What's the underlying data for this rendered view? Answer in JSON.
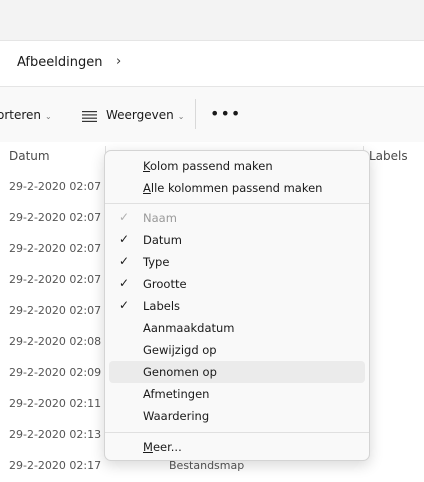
{
  "breadcrumb": {
    "current": "Afbeeldingen",
    "separator": "›"
  },
  "toolbar": {
    "sort_label": "orteren",
    "view_label": "Weergeven",
    "more_label": "•••"
  },
  "columns": {
    "datum": "Datum",
    "labels": "Labels"
  },
  "rows": [
    {
      "date": "29-2-2020 02:07",
      "type": ""
    },
    {
      "date": "29-2-2020 02:07",
      "type": ""
    },
    {
      "date": "29-2-2020 02:07",
      "type": ""
    },
    {
      "date": "29-2-2020 02:07",
      "type": ""
    },
    {
      "date": "29-2-2020 02:07",
      "type": ""
    },
    {
      "date": "29-2-2020 02:08",
      "type": ""
    },
    {
      "date": "29-2-2020 02:09",
      "type": ""
    },
    {
      "date": "29-2-2020 02:11",
      "type": ""
    },
    {
      "date": "29-2-2020 02:13",
      "type": ""
    },
    {
      "date": "29-2-2020 02:17",
      "type": "Bestandsmap"
    }
  ],
  "menu": {
    "top": [
      {
        "accel": "K",
        "rest": "olom passend maken"
      },
      {
        "accel": "A",
        "rest": "lle kolommen passend maken"
      }
    ],
    "columns": [
      {
        "label": "Naam",
        "checked": true,
        "disabled": true
      },
      {
        "label": "Datum",
        "checked": true
      },
      {
        "label": "Type",
        "checked": true
      },
      {
        "label": "Grootte",
        "checked": true
      },
      {
        "label": "Labels",
        "checked": true
      },
      {
        "label": "Aanmaakdatum",
        "checked": false
      },
      {
        "label": "Gewijzigd op",
        "checked": false
      },
      {
        "label": "Genomen op",
        "checked": false,
        "highlighted": true
      },
      {
        "label": "Afmetingen",
        "checked": false
      },
      {
        "label": "Waardering",
        "checked": false
      }
    ],
    "more": {
      "accel": "M",
      "rest": "eer..."
    }
  }
}
